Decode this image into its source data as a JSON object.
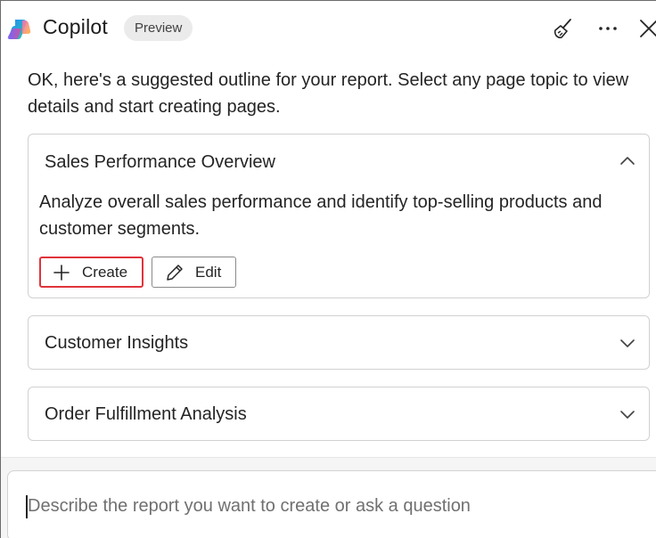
{
  "header": {
    "app_title": "Copilot",
    "badge": "Preview",
    "icons": [
      "copilot-logo",
      "broom-icon",
      "more-icon",
      "close-icon"
    ]
  },
  "main": {
    "intro": "OK, here's a suggested outline for your report. Select any page topic to view details and start creating pages.",
    "topics": [
      {
        "title": "Sales Performance Overview",
        "expanded": true,
        "description": "Analyze overall sales performance and identify top-selling products and customer segments.",
        "create_label": "Create",
        "edit_label": "Edit"
      },
      {
        "title": "Customer Insights",
        "expanded": false
      },
      {
        "title": "Order Fulfillment Analysis",
        "expanded": false
      }
    ]
  },
  "composer": {
    "placeholder": "Describe the report you want to create or ask a question"
  },
  "colors": {
    "highlight_border": "#e0333b",
    "card_border": "#d1d1d1",
    "badge_bg": "#ebebeb"
  }
}
